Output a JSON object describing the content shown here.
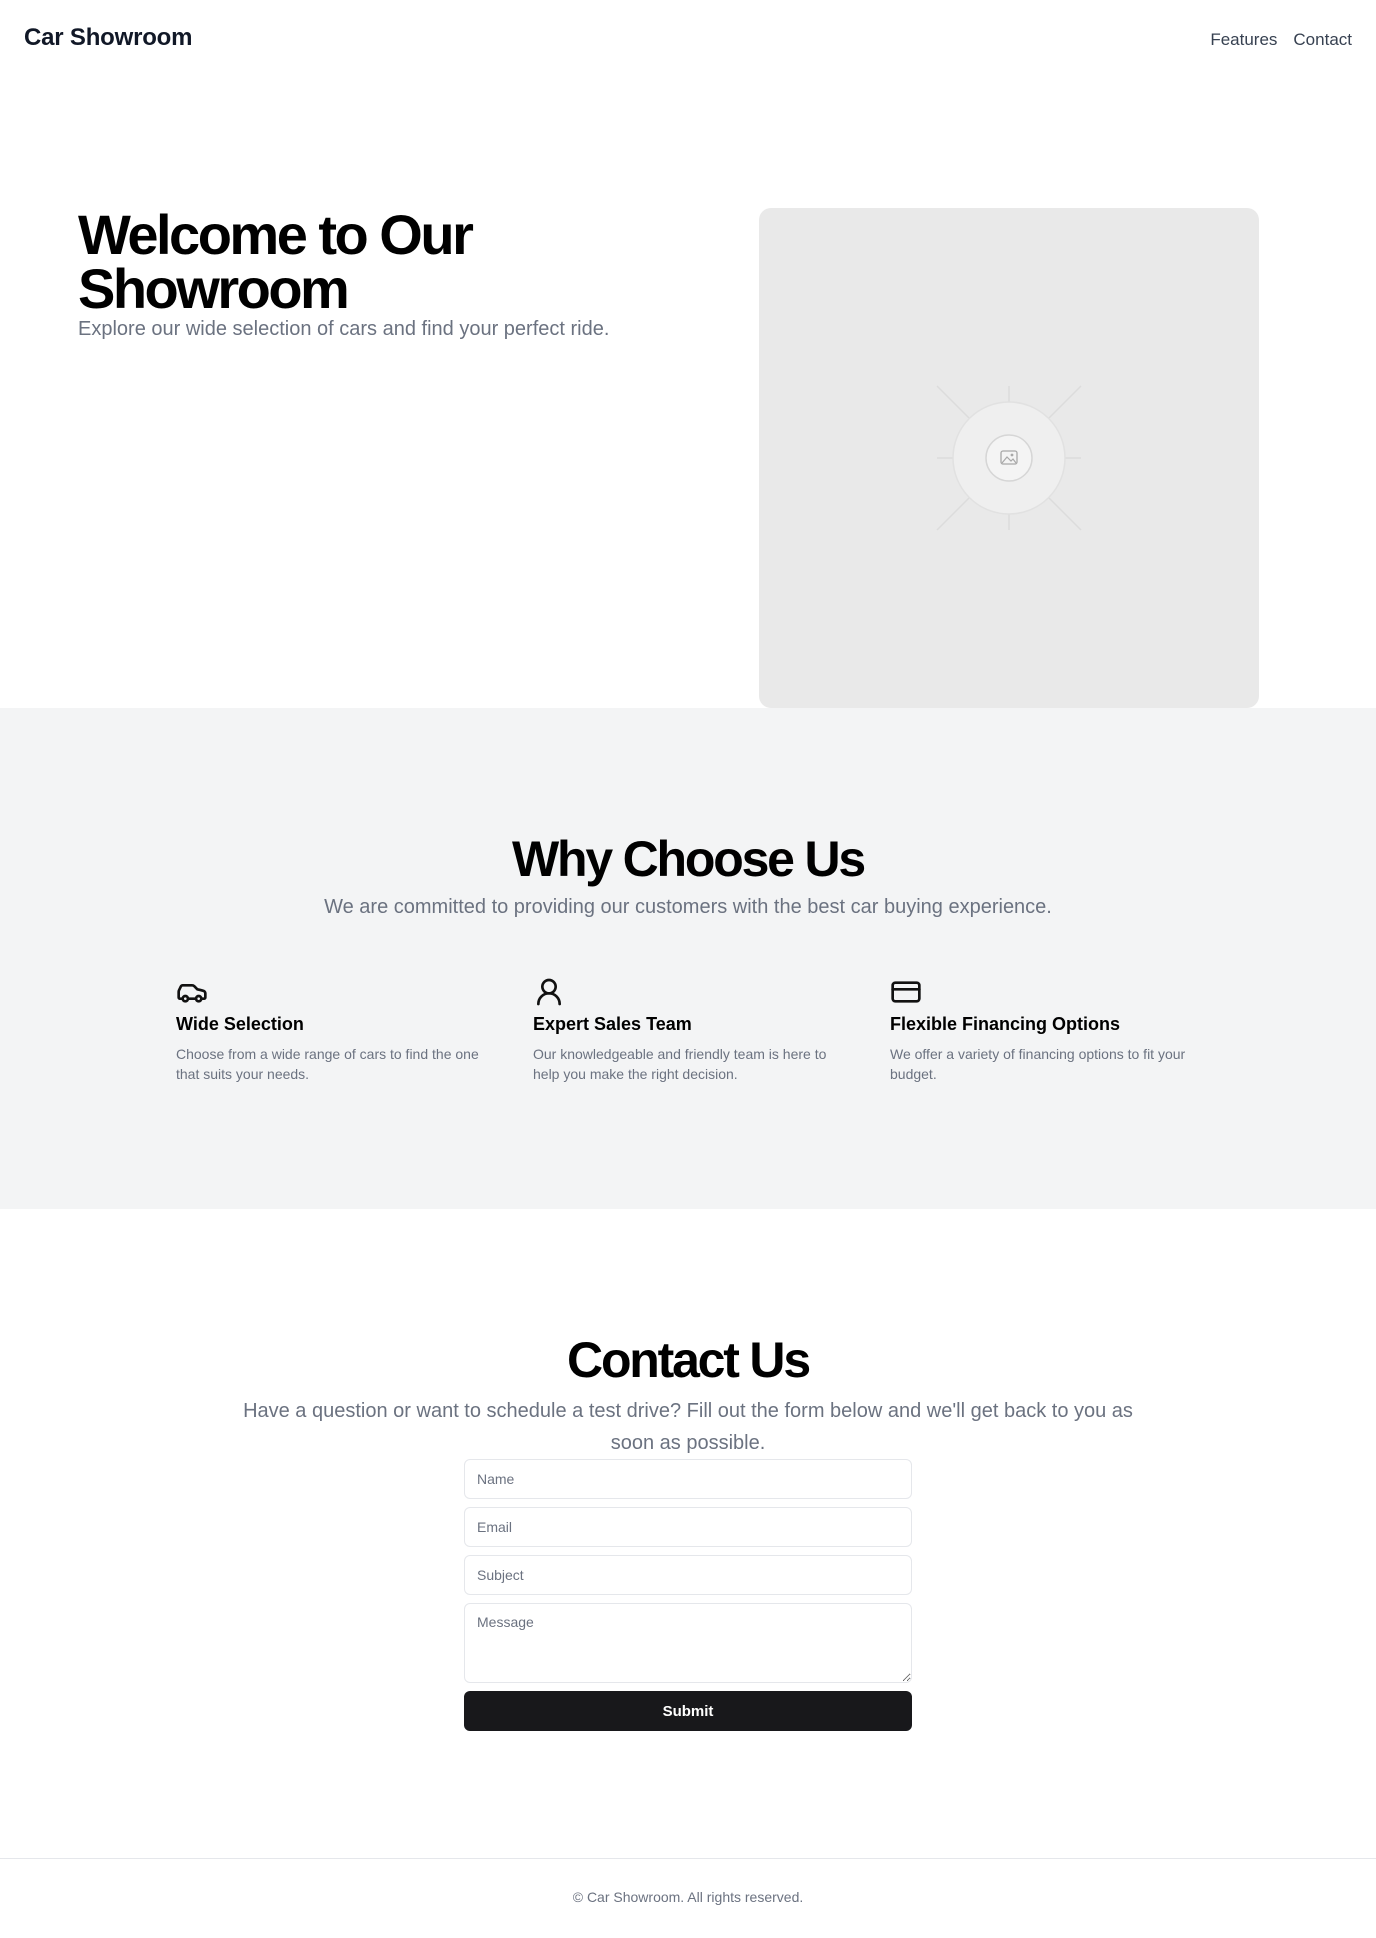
{
  "header": {
    "brand": "Car Showroom",
    "nav": [
      {
        "label": "Features"
      },
      {
        "label": "Contact"
      }
    ]
  },
  "hero": {
    "title": "Welcome to Our Showroom",
    "subtitle": "Explore our wide selection of cars and find your perfect ride.",
    "image_icon": "image-placeholder-icon"
  },
  "features": {
    "title": "Why Choose Us",
    "subtitle": "We are committed to providing our customers with the best car buying experience.",
    "items": [
      {
        "icon": "car-icon",
        "title": "Wide Selection",
        "text": "Choose from a wide range of cars to find the one that suits your needs."
      },
      {
        "icon": "user-icon",
        "title": "Expert Sales Team",
        "text": "Our knowledgeable and friendly team is here to help you make the right decision."
      },
      {
        "icon": "credit-card-icon",
        "title": "Flexible Financing Options",
        "text": "We offer a variety of financing options to fit your budget."
      }
    ]
  },
  "contact": {
    "title": "Contact Us",
    "subtitle": "Have a question or want to schedule a test drive? Fill out the form below and we'll get back to you as soon as possible.",
    "name_placeholder": "Name",
    "email_placeholder": "Email",
    "subject_placeholder": "Subject",
    "message_placeholder": "Message",
    "submit_label": "Submit"
  },
  "footer": {
    "text": "© Car Showroom. All rights reserved."
  },
  "colors": {
    "primary_button": "#18181b",
    "section_bg": "#f3f4f5",
    "muted_text": "#6b7280"
  }
}
